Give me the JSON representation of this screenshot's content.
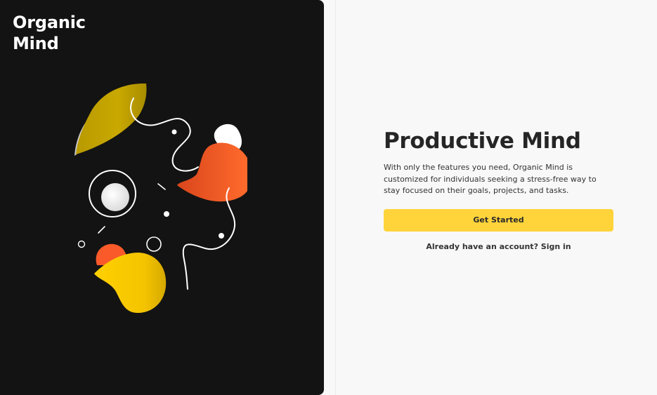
{
  "brand": {
    "line1": "Organic",
    "line2": "Mind"
  },
  "illustration": {
    "name": "abstract-organic-shapes",
    "colors": {
      "yellow": "#ffd000",
      "olive": "#c2a200",
      "orange": "#fa5a2a",
      "white": "#ffffff",
      "gray": "#c8c8c8"
    }
  },
  "main": {
    "title": "Productive Mind",
    "description": "With only the features you need, Organic Mind is customized for individuals seeking a stress-free way to stay focused on their goals, projects, and tasks.",
    "cta_label": "Get Started",
    "signin_prompt": "Already have an account?",
    "signin_link": "Sign in"
  },
  "colors": {
    "left_background": "#131313",
    "right_background": "#f8f8f8",
    "accent": "#ffd43b",
    "text": "#252525"
  }
}
